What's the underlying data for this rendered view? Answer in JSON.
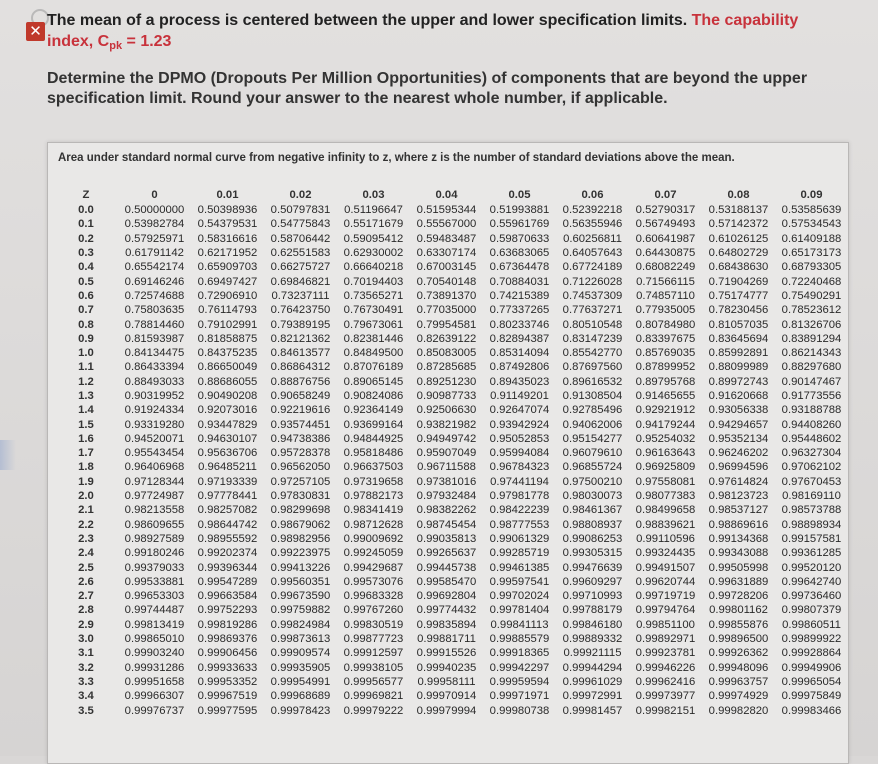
{
  "question": {
    "line1_prefix": "The mean of a process is centered between the upper and lower specification limits.",
    "line1_red": "The capability",
    "line2_red_a": "index, C",
    "line2_red_sub": "pk",
    "line2_red_b": " = 1.23",
    "body_line1": "Determine the DPMO (Dropouts Per Million Opportunities) of components that are beyond the upper",
    "body_line2": "specification limit. Round your answer to the nearest whole number, if applicable."
  },
  "table": {
    "caption": "Area under standard normal curve from negative infinity to z, where z is the number of standard deviations above the mean.",
    "headers": [
      "Z",
      "0",
      "0.01",
      "0.02",
      "0.03",
      "0.04",
      "0.05",
      "0.06",
      "0.07",
      "0.08",
      "0.09"
    ],
    "rows": [
      [
        "0.0",
        "0.50000000",
        "0.50398936",
        "0.50797831",
        "0.51196647",
        "0.51595344",
        "0.51993881",
        "0.52392218",
        "0.52790317",
        "0.53188137",
        "0.53585639"
      ],
      [
        "0.1",
        "0.53982784",
        "0.54379531",
        "0.54775843",
        "0.55171679",
        "0.55567000",
        "0.55961769",
        "0.56355946",
        "0.56749493",
        "0.57142372",
        "0.57534543"
      ],
      [
        "0.2",
        "0.57925971",
        "0.58316616",
        "0.58706442",
        "0.59095412",
        "0.59483487",
        "0.59870633",
        "0.60256811",
        "0.60641987",
        "0.61026125",
        "0.61409188"
      ],
      [
        "0.3",
        "0.61791142",
        "0.62171952",
        "0.62551583",
        "0.62930002",
        "0.63307174",
        "0.63683065",
        "0.64057643",
        "0.64430875",
        "0.64802729",
        "0.65173173"
      ],
      [
        "0.4",
        "0.65542174",
        "0.65909703",
        "0.66275727",
        "0.66640218",
        "0.67003145",
        "0.67364478",
        "0.67724189",
        "0.68082249",
        "0.68438630",
        "0.68793305"
      ],
      [
        "0.5",
        "0.69146246",
        "0.69497427",
        "0.69846821",
        "0.70194403",
        "0.70540148",
        "0.70884031",
        "0.71226028",
        "0.71566115",
        "0.71904269",
        "0.72240468"
      ],
      [
        "0.6",
        "0.72574688",
        "0.72906910",
        "0.73237111",
        "0.73565271",
        "0.73891370",
        "0.74215389",
        "0.74537309",
        "0.74857110",
        "0.75174777",
        "0.75490291"
      ],
      [
        "0.7",
        "0.75803635",
        "0.76114793",
        "0.76423750",
        "0.76730491",
        "0.77035000",
        "0.77337265",
        "0.77637271",
        "0.77935005",
        "0.78230456",
        "0.78523612"
      ],
      [
        "0.8",
        "0.78814460",
        "0.79102991",
        "0.79389195",
        "0.79673061",
        "0.79954581",
        "0.80233746",
        "0.80510548",
        "0.80784980",
        "0.81057035",
        "0.81326706"
      ],
      [
        "0.9",
        "0.81593987",
        "0.81858875",
        "0.82121362",
        "0.82381446",
        "0.82639122",
        "0.82894387",
        "0.83147239",
        "0.83397675",
        "0.83645694",
        "0.83891294"
      ],
      [
        "1.0",
        "0.84134475",
        "0.84375235",
        "0.84613577",
        "0.84849500",
        "0.85083005",
        "0.85314094",
        "0.85542770",
        "0.85769035",
        "0.85992891",
        "0.86214343"
      ],
      [
        "1.1",
        "0.86433394",
        "0.86650049",
        "0.86864312",
        "0.87076189",
        "0.87285685",
        "0.87492806",
        "0.87697560",
        "0.87899952",
        "0.88099989",
        "0.88297680"
      ],
      [
        "1.2",
        "0.88493033",
        "0.88686055",
        "0.88876756",
        "0.89065145",
        "0.89251230",
        "0.89435023",
        "0.89616532",
        "0.89795768",
        "0.89972743",
        "0.90147467"
      ],
      [
        "1.3",
        "0.90319952",
        "0.90490208",
        "0.90658249",
        "0.90824086",
        "0.90987733",
        "0.91149201",
        "0.91308504",
        "0.91465655",
        "0.91620668",
        "0.91773556"
      ],
      [
        "1.4",
        "0.91924334",
        "0.92073016",
        "0.92219616",
        "0.92364149",
        "0.92506630",
        "0.92647074",
        "0.92785496",
        "0.92921912",
        "0.93056338",
        "0.93188788"
      ],
      [
        "1.5",
        "0.93319280",
        "0.93447829",
        "0.93574451",
        "0.93699164",
        "0.93821982",
        "0.93942924",
        "0.94062006",
        "0.94179244",
        "0.94294657",
        "0.94408260"
      ],
      [
        "1.6",
        "0.94520071",
        "0.94630107",
        "0.94738386",
        "0.94844925",
        "0.94949742",
        "0.95052853",
        "0.95154277",
        "0.95254032",
        "0.95352134",
        "0.95448602"
      ],
      [
        "1.7",
        "0.95543454",
        "0.95636706",
        "0.95728378",
        "0.95818486",
        "0.95907049",
        "0.95994084",
        "0.96079610",
        "0.96163643",
        "0.96246202",
        "0.96327304"
      ],
      [
        "1.8",
        "0.96406968",
        "0.96485211",
        "0.96562050",
        "0.96637503",
        "0.96711588",
        "0.96784323",
        "0.96855724",
        "0.96925809",
        "0.96994596",
        "0.97062102"
      ],
      [
        "1.9",
        "0.97128344",
        "0.97193339",
        "0.97257105",
        "0.97319658",
        "0.97381016",
        "0.97441194",
        "0.97500210",
        "0.97558081",
        "0.97614824",
        "0.97670453"
      ],
      [
        "2.0",
        "0.97724987",
        "0.97778441",
        "0.97830831",
        "0.97882173",
        "0.97932484",
        "0.97981778",
        "0.98030073",
        "0.98077383",
        "0.98123723",
        "0.98169110"
      ],
      [
        "2.1",
        "0.98213558",
        "0.98257082",
        "0.98299698",
        "0.98341419",
        "0.98382262",
        "0.98422239",
        "0.98461367",
        "0.98499658",
        "0.98537127",
        "0.98573788"
      ],
      [
        "2.2",
        "0.98609655",
        "0.98644742",
        "0.98679062",
        "0.98712628",
        "0.98745454",
        "0.98777553",
        "0.98808937",
        "0.98839621",
        "0.98869616",
        "0.98898934"
      ],
      [
        "2.3",
        "0.98927589",
        "0.98955592",
        "0.98982956",
        "0.99009692",
        "0.99035813",
        "0.99061329",
        "0.99086253",
        "0.99110596",
        "0.99134368",
        "0.99157581"
      ],
      [
        "2.4",
        "0.99180246",
        "0.99202374",
        "0.99223975",
        "0.99245059",
        "0.99265637",
        "0.99285719",
        "0.99305315",
        "0.99324435",
        "0.99343088",
        "0.99361285"
      ],
      [
        "2.5",
        "0.99379033",
        "0.99396344",
        "0.99413226",
        "0.99429687",
        "0.99445738",
        "0.99461385",
        "0.99476639",
        "0.99491507",
        "0.99505998",
        "0.99520120"
      ],
      [
        "2.6",
        "0.99533881",
        "0.99547289",
        "0.99560351",
        "0.99573076",
        "0.99585470",
        "0.99597541",
        "0.99609297",
        "0.99620744",
        "0.99631889",
        "0.99642740"
      ],
      [
        "2.7",
        "0.99653303",
        "0.99663584",
        "0.99673590",
        "0.99683328",
        "0.99692804",
        "0.99702024",
        "0.99710993",
        "0.99719719",
        "0.99728206",
        "0.99736460"
      ],
      [
        "2.8",
        "0.99744487",
        "0.99752293",
        "0.99759882",
        "0.99767260",
        "0.99774432",
        "0.99781404",
        "0.99788179",
        "0.99794764",
        "0.99801162",
        "0.99807379"
      ],
      [
        "2.9",
        "0.99813419",
        "0.99819286",
        "0.99824984",
        "0.99830519",
        "0.99835894",
        "0.99841113",
        "0.99846180",
        "0.99851100",
        "0.99855876",
        "0.99860511"
      ],
      [
        "3.0",
        "0.99865010",
        "0.99869376",
        "0.99873613",
        "0.99877723",
        "0.99881711",
        "0.99885579",
        "0.99889332",
        "0.99892971",
        "0.99896500",
        "0.99899922"
      ],
      [
        "3.1",
        "0.99903240",
        "0.99906456",
        "0.99909574",
        "0.99912597",
        "0.99915526",
        "0.99918365",
        "0.99921115",
        "0.99923781",
        "0.99926362",
        "0.99928864"
      ],
      [
        "3.2",
        "0.99931286",
        "0.99933633",
        "0.99935905",
        "0.99938105",
        "0.99940235",
        "0.99942297",
        "0.99944294",
        "0.99946226",
        "0.99948096",
        "0.99949906"
      ],
      [
        "3.3",
        "0.99951658",
        "0.99953352",
        "0.99954991",
        "0.99956577",
        "0.99958111",
        "0.99959594",
        "0.99961029",
        "0.99962416",
        "0.99963757",
        "0.99965054"
      ],
      [
        "3.4",
        "0.99966307",
        "0.99967519",
        "0.99968689",
        "0.99969821",
        "0.99970914",
        "0.99971971",
        "0.99972991",
        "0.99973977",
        "0.99974929",
        "0.99975849"
      ],
      [
        "3.5",
        "0.99976737",
        "0.99977595",
        "0.99978423",
        "0.99979222",
        "0.99979994",
        "0.99980738",
        "0.99981457",
        "0.99982151",
        "0.99982820",
        "0.99983466"
      ]
    ]
  },
  "icons": {
    "question_icon": "incorrect-x-icon"
  },
  "colors": {
    "accent_red": "#c8323b"
  }
}
